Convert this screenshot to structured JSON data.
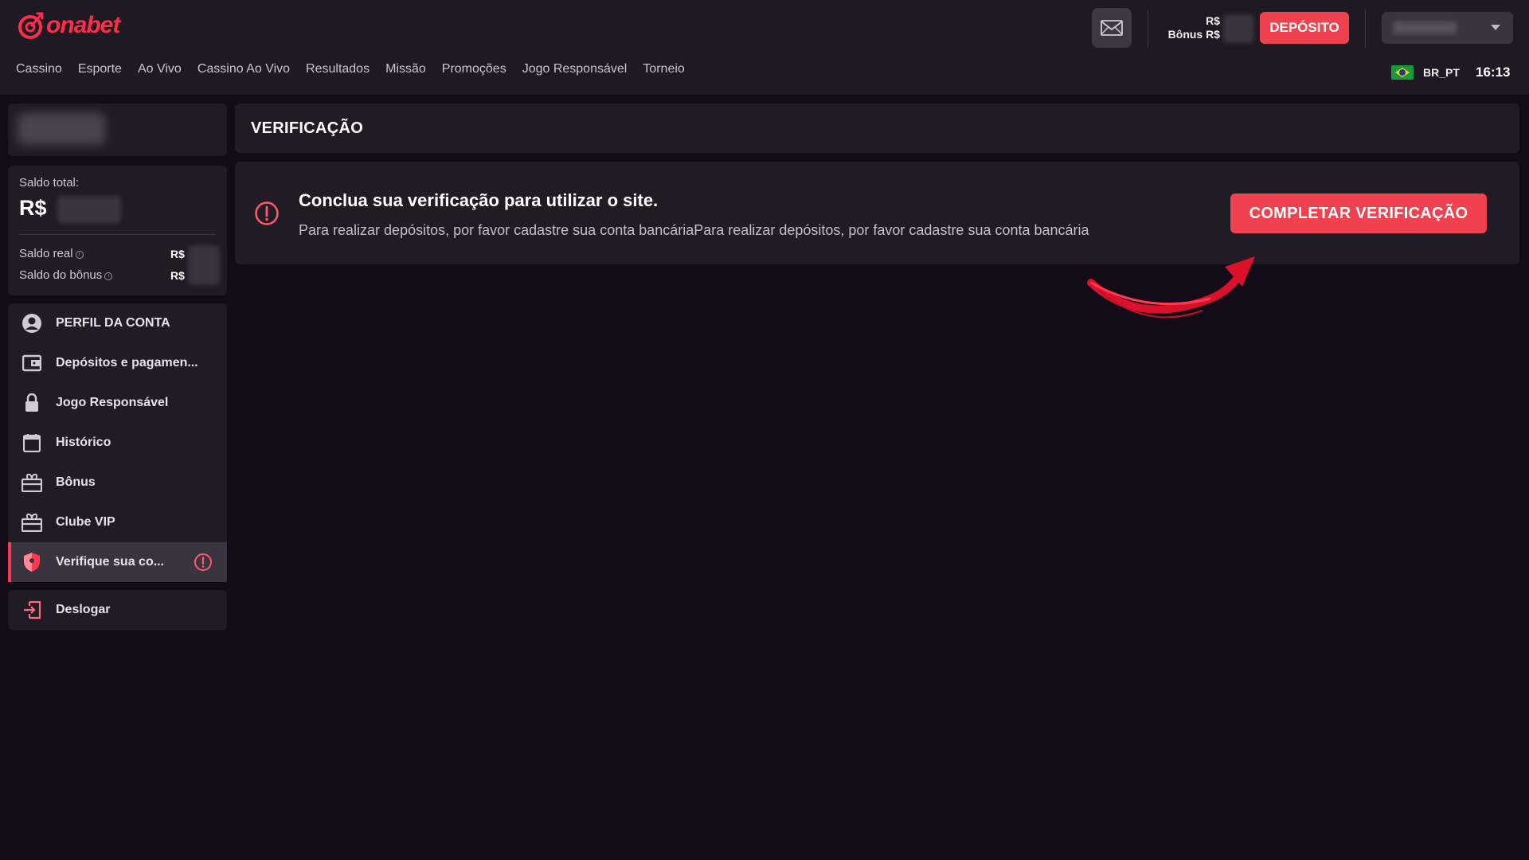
{
  "brand": {
    "logo_text": "onabet"
  },
  "nav": {
    "items": [
      "Cassino",
      "Esporte",
      "Ao Vivo",
      "Cassino Ao Vivo",
      "Resultados",
      "Missão",
      "Promoções",
      "Jogo Responsável",
      "Torneio"
    ]
  },
  "header": {
    "balance_label": "R$",
    "bonus_label": "Bônus R$",
    "deposit_label": "DEPÓSITO",
    "language": "BR_PT",
    "time": "16:13"
  },
  "sidebar": {
    "total_label": "Saldo total:",
    "total_currency": "R$",
    "real_label": "Saldo real",
    "real_currency": "R$",
    "bonus_label": "Saldo do bônus",
    "bonus_currency": "R$",
    "items": [
      {
        "label": "PERFIL DA CONTA",
        "icon": "user-circle-icon"
      },
      {
        "label": "Depósitos e pagamen...",
        "icon": "wallet-icon"
      },
      {
        "label": "Jogo Responsável",
        "icon": "lock-icon"
      },
      {
        "label": "Histórico",
        "icon": "calendar-icon"
      },
      {
        "label": "Bônus",
        "icon": "gift-icon"
      },
      {
        "label": "Clube VIP",
        "icon": "gift-icon"
      },
      {
        "label": "Verifique sua co...",
        "icon": "shield-icon",
        "active": true
      }
    ],
    "logout_label": "Deslogar"
  },
  "main": {
    "page_title": "VERIFICAÇÃO",
    "notice_title": "Conclua sua verificação para utilizar o site.",
    "notice_text": "Para realizar depósitos, por favor cadastre sua conta bancáriaPara realizar depósitos, por favor cadastre sua conta bancária",
    "cta_label": "COMPLETAR VERIFICAÇÃO"
  },
  "colors": {
    "accent": "#f0414f",
    "background": "#130c18",
    "panel": "#201b25"
  }
}
